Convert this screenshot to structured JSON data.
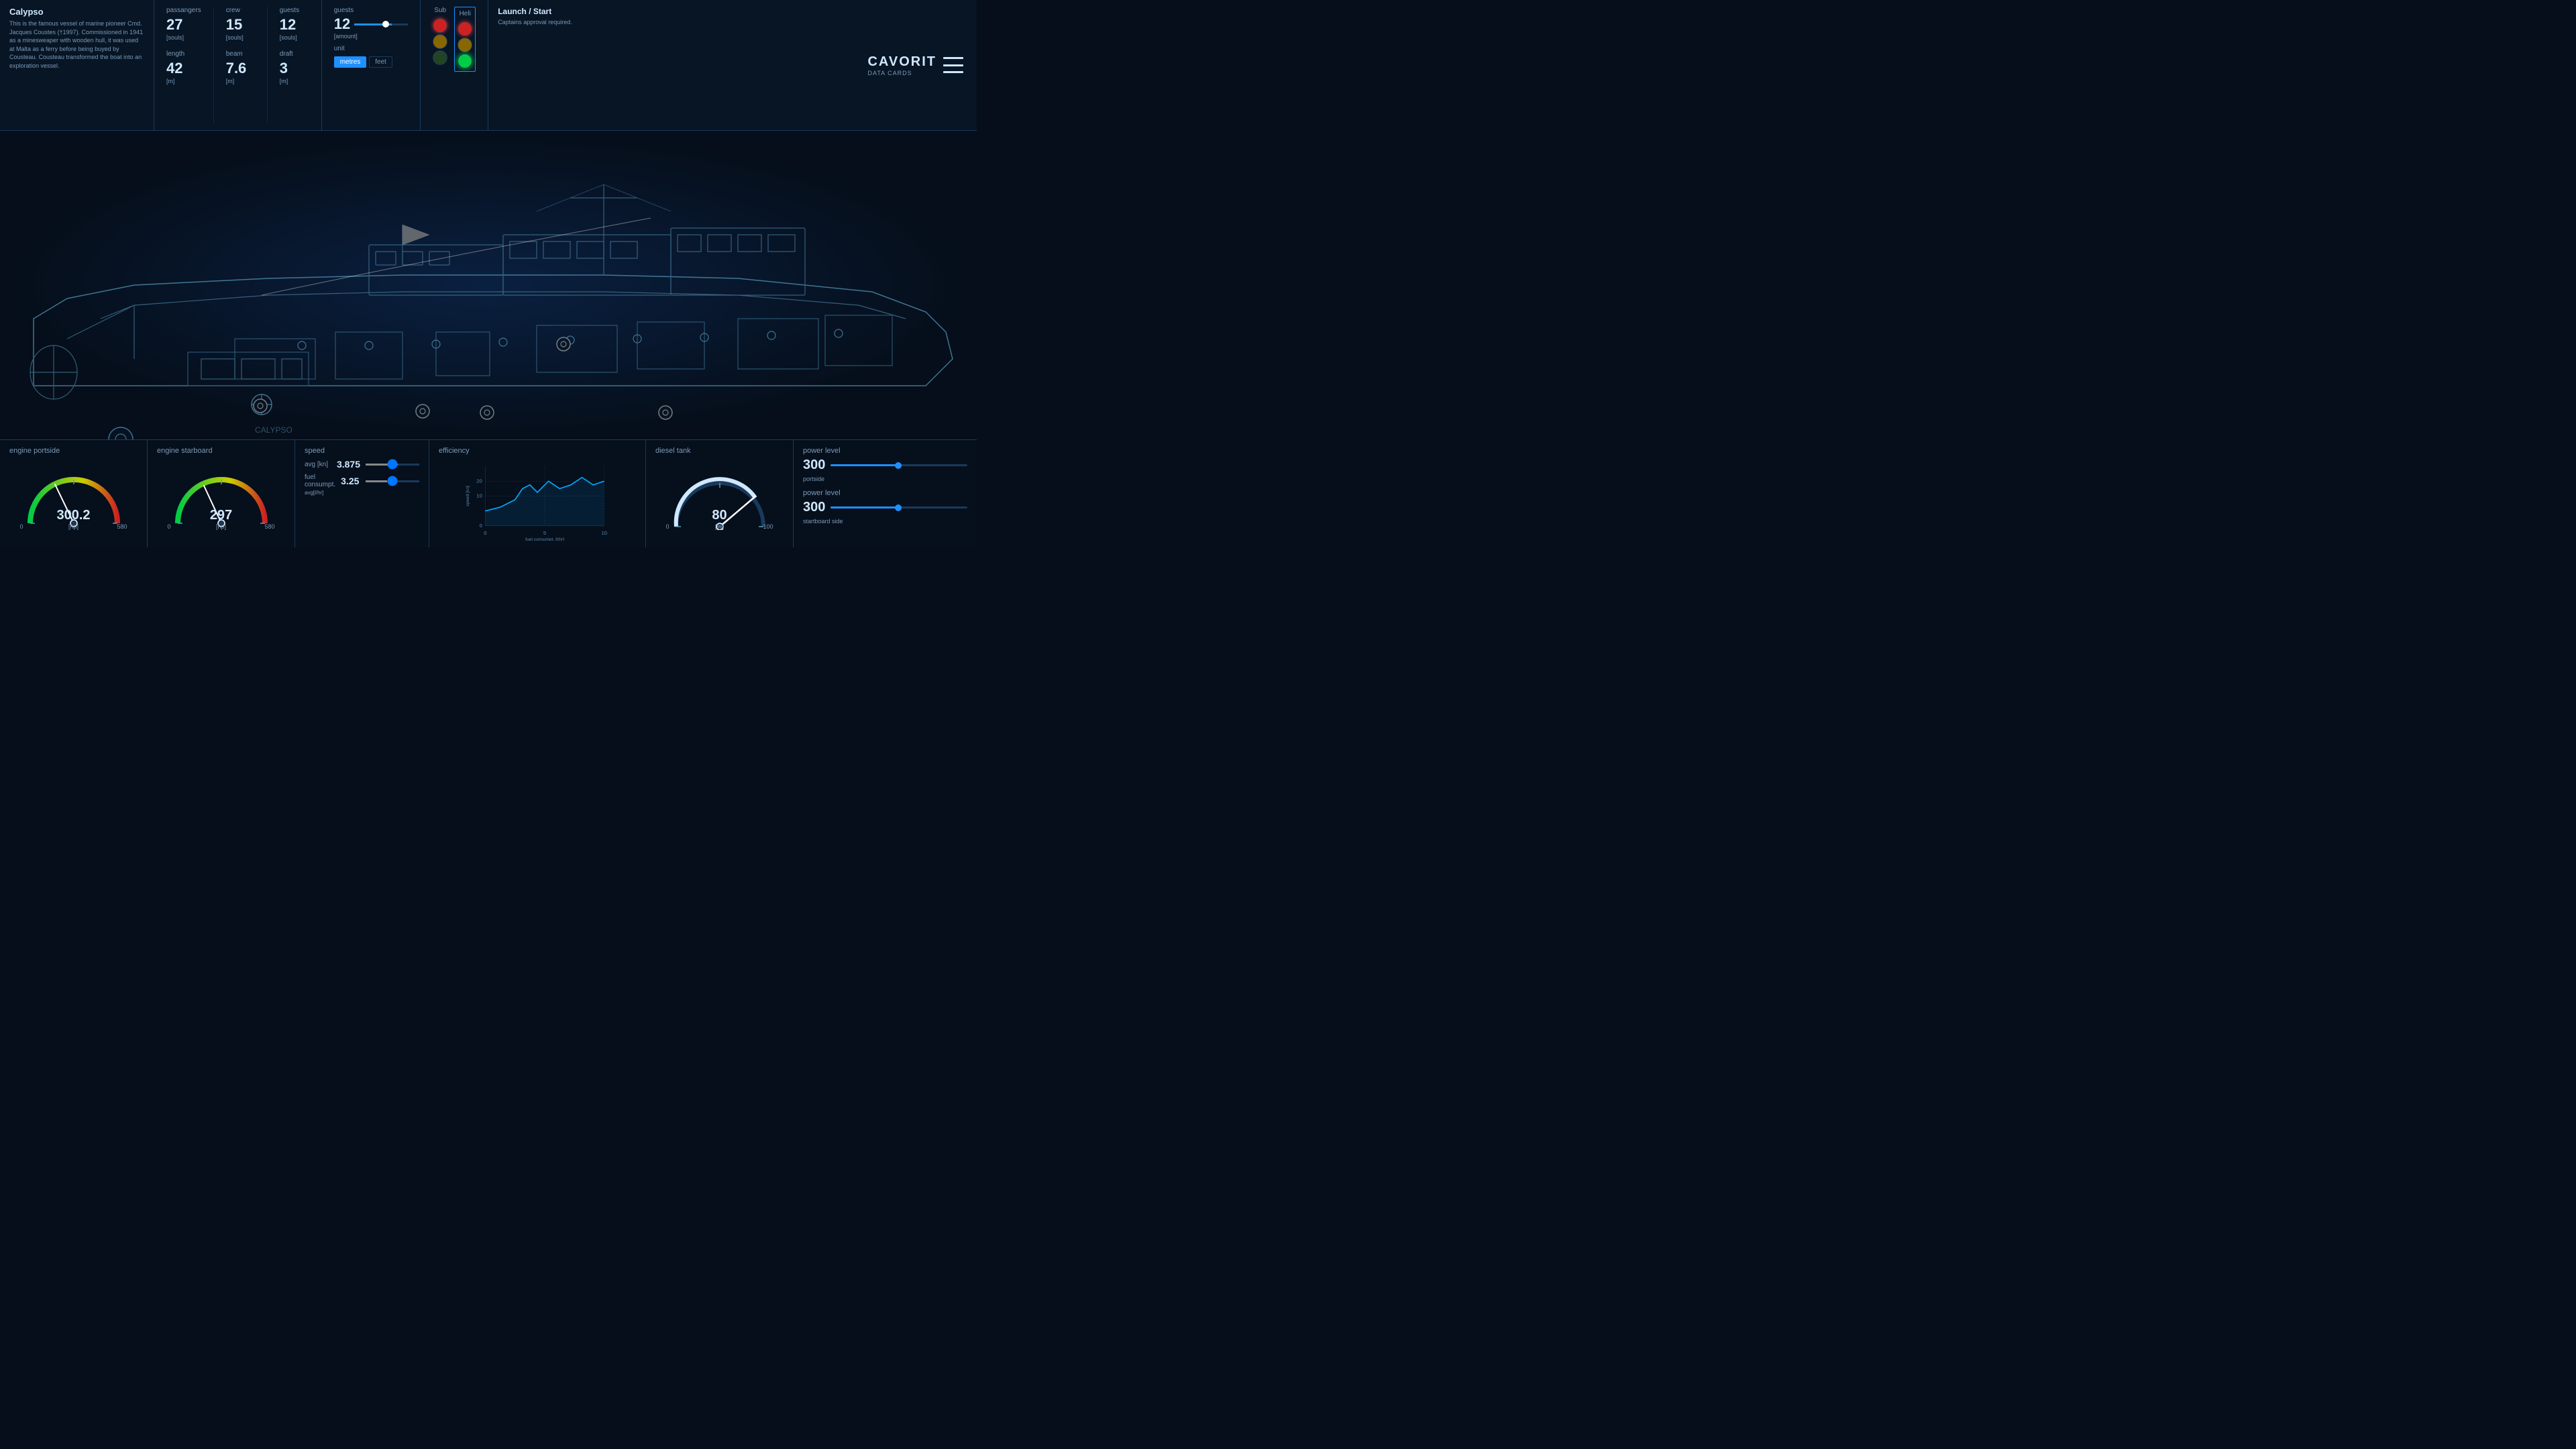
{
  "app": {
    "title": "CAVORIT DATA CARDS",
    "logo": "CAVORIT",
    "logo_sub": "DATA\nCARDS"
  },
  "vessel": {
    "name": "Calypso",
    "description": "This is the famous vessel of marine pioneer Cmd. Jacques Coustes (†1997). Commissioned in 1941 as a minesweaper with wooden hull, it was used at Malta as a ferry before being buyed by Cousteau. Cousteau transformed the boat into an exploration vessel."
  },
  "stats": {
    "passangers_label": "passangers",
    "passangers_value": "27",
    "passangers_unit": "[souls]",
    "crew_label": "crew",
    "crew_value": "15",
    "crew_unit": "[souls]",
    "guests_label": "guests",
    "guests_value": "12",
    "guests_unit": "[souls]",
    "length_label": "length",
    "length_value": "42",
    "length_unit": "[m]",
    "beam_label": "beam",
    "beam_value": "7.6",
    "beam_unit": "[m]",
    "draft_label": "draft",
    "draft_value": "3",
    "draft_unit": "[m]"
  },
  "guests_control": {
    "label": "guests",
    "value": "12",
    "unit_label": "[amount]",
    "unit_toggle": {
      "metres_label": "metres",
      "feet_label": "feet",
      "active": "metres"
    },
    "unit_row_label": "unit"
  },
  "traffic_lights": {
    "sub_label": "Sub",
    "heli_label": "Heli",
    "sub_lights": [
      "red_on",
      "yellow_off",
      "green_off"
    ],
    "heli_lights": [
      "red_on",
      "yellow_off",
      "green_on"
    ]
  },
  "launch": {
    "label": "Launch / Start",
    "description": "Captains approval required."
  },
  "engine_portside": {
    "title": "engine portside",
    "value": "300.2",
    "unit": "[hp]",
    "min": "0",
    "max": "580"
  },
  "engine_starboard": {
    "title": "engine starboard",
    "value": "297",
    "unit": "[hp]",
    "min": "0",
    "max": "580"
  },
  "speed": {
    "title": "speed",
    "avg_label": "avg [kn]",
    "avg_value": "3.875",
    "fuel_label": "fuel consumpt.",
    "fuel_value": "3.25",
    "fuel_unit": "avg[l/hr]",
    "chart_x_label": "fuel consumpt. [l/hr]",
    "chart_y_label": "speed [kn]",
    "chart_x_max": "10",
    "chart_x_mid": "5",
    "chart_y_values": [
      "20",
      "10"
    ]
  },
  "efficiency": {
    "title": "efficiency"
  },
  "diesel_tank": {
    "title": "diesel tank",
    "value": "80",
    "unit": "[%]",
    "max": "100",
    "min": "0"
  },
  "power_level": {
    "portside_title": "power level",
    "portside_value": "300",
    "portside_label": "portside",
    "starboard_title": "power level",
    "starboard_value": "300",
    "starboard_label": "startboard side",
    "slider_percent": "52"
  }
}
